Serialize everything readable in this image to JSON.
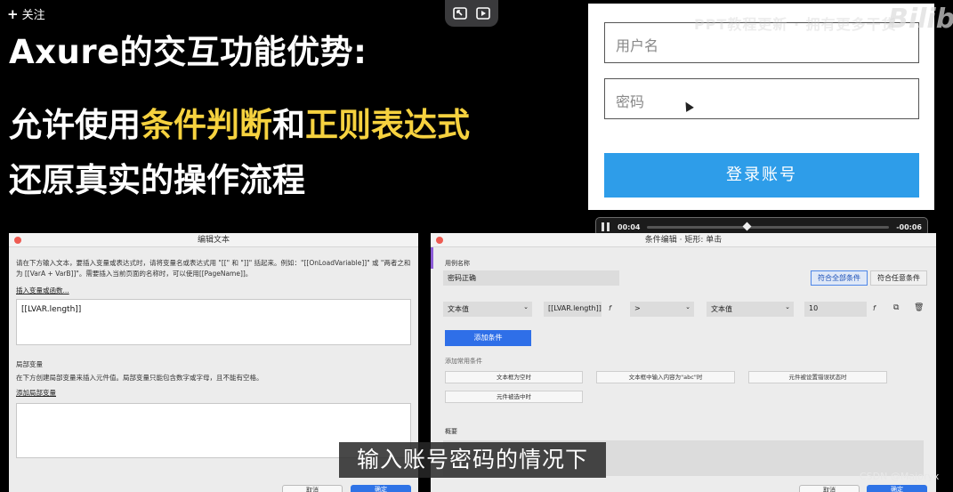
{
  "top": {
    "follow_label": "关注"
  },
  "headline": {
    "line1": "Axure的交互功能优势:",
    "line2_a": "允许使用",
    "line2_hl1": "条件判断",
    "line2_b": "和",
    "line2_hl2": "正则表达式",
    "line3": "还原真实的操作流程",
    "highlight_color": "#f6d23f"
  },
  "login": {
    "username_placeholder": "用户名",
    "password_placeholder": "密码",
    "login_button": "登录账号",
    "button_color": "#2e9de9"
  },
  "watermark": {
    "text": "Bilibili",
    "faint": "PPT教程更新 · 拥有更多干货"
  },
  "video": {
    "current": "00:04",
    "remaining": "-00:06",
    "progress": 0.4
  },
  "edit_text_dialog": {
    "title": "编辑文本",
    "description": "请在下方输入文本，要插入变量或表达式时，请将变量名或表达式用 \"[[\" 和 \"]]\" 括起来。例如：\"[[OnLoadVariable]]\" 或 \"两者之和为 [[VarA + VarB]]\"。需要插入当前页面的名称时，可以使用[[PageName]]。",
    "insert_link": "插入变量或函数...",
    "expression": "[[LVAR.length]]",
    "local_vars_label": "局部变量",
    "local_vars_desc": "在下方创建局部变量来插入元件值。局部变量只能包含数字或字母，且不能有空格。",
    "add_local_var": "添加局部变量",
    "cancel": "取消",
    "ok": "确定"
  },
  "condition_dialog": {
    "title": "条件编辑 · 矩形: 单击",
    "case_name_label": "用例名称",
    "case_name": "密码正确",
    "match_all": "符合全部条件",
    "match_any": "符合任意条件",
    "cond_type1": "文本值",
    "cond_value1": "[[LVAR.length]]",
    "operator": ">",
    "cond_type2": "文本值",
    "cond_value2": "10",
    "add_condition": "添加条件",
    "common_label": "添加常用条件",
    "chips": [
      "文本框为空时",
      "文本框中输入内容为\"abc\"时",
      "元件被设置错误状态时",
      "元件被选中时"
    ],
    "summary_label": "概要",
    "cancel": "取消",
    "ok": "确定"
  },
  "subtitle": "输入账号密码的情况下",
  "credit": "CSDN @Majoryx"
}
